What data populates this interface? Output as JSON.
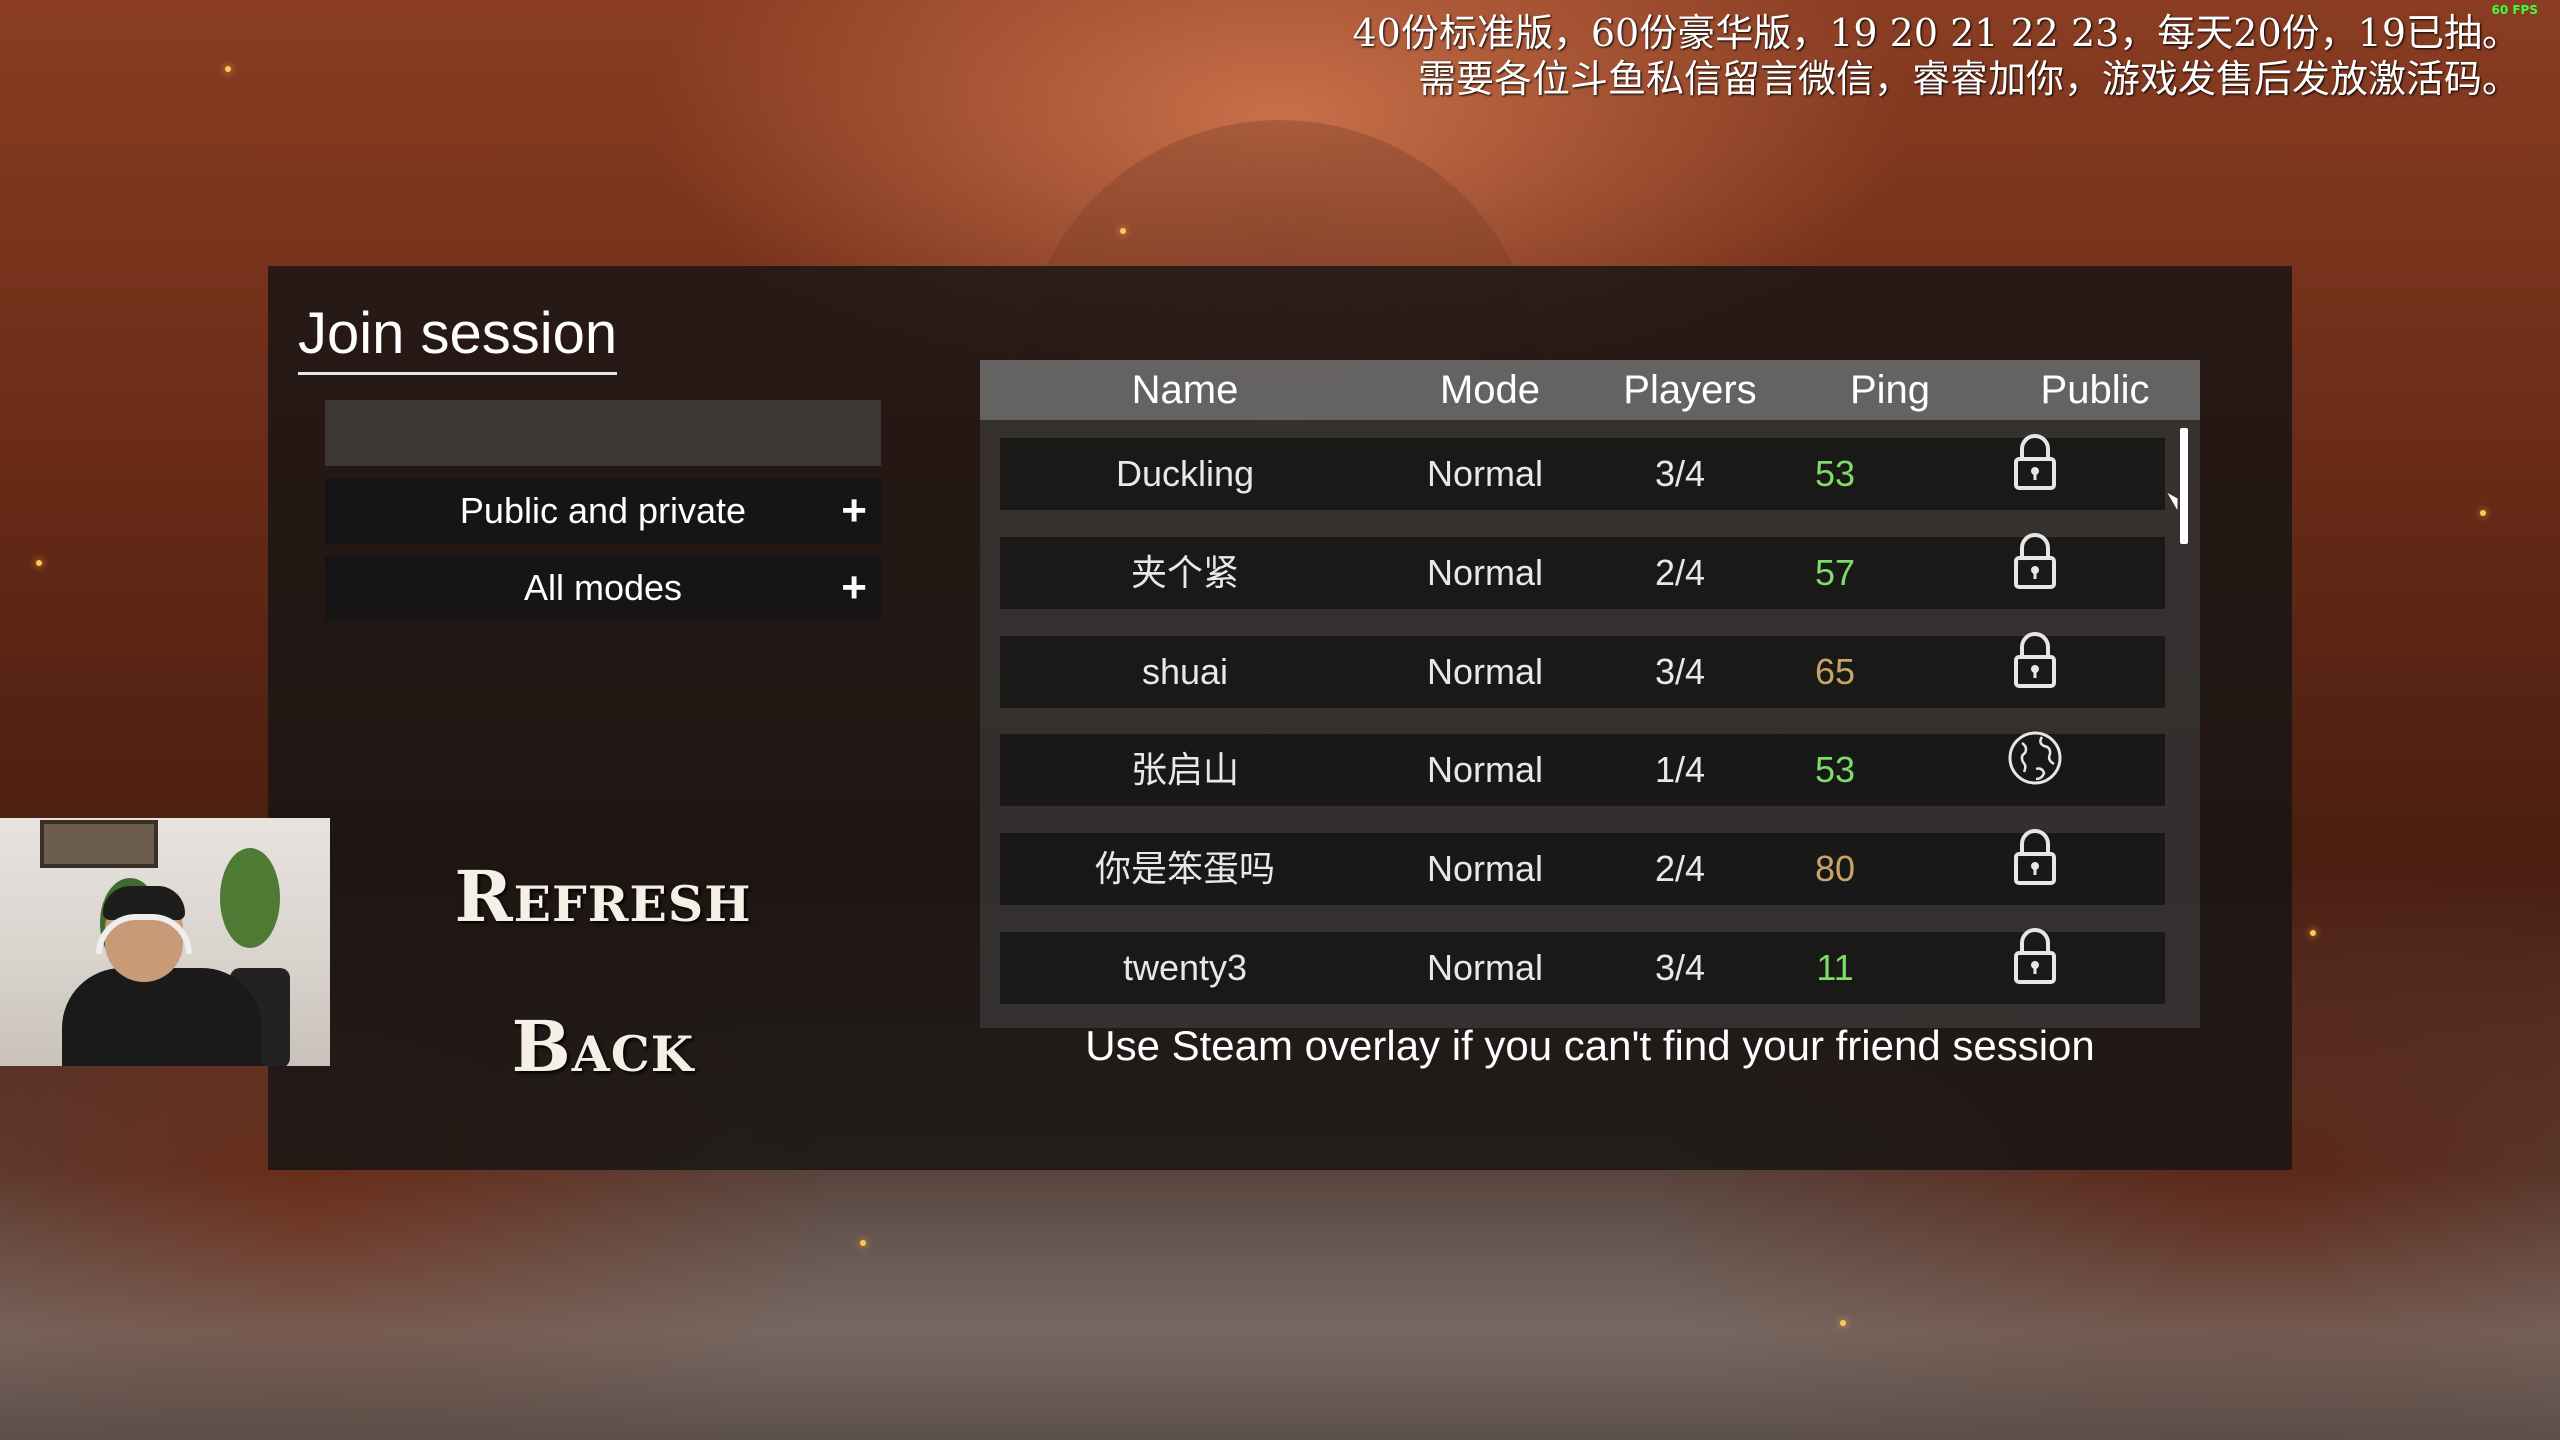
{
  "overlay": {
    "fps": "60 FPS",
    "announce_line1": "40份标准版，60份豪华版，19 20 21 22 23，每天20份，19已抽。",
    "announce_line2": "需要各位斗鱼私信留言微信，睿睿加你，游戏发售后发放激活码。"
  },
  "menu": {
    "title": "Join session",
    "search_value": "",
    "filter_visibility": "Public and private",
    "filter_mode": "All modes",
    "filter_expand_symbol": "+",
    "refresh_label": "Refresh",
    "back_label": "Back"
  },
  "table": {
    "headers": {
      "name": "Name",
      "mode": "Mode",
      "players": "Players",
      "ping": "Ping",
      "public": "Public"
    },
    "rows": [
      {
        "name": "Duckling",
        "mode": "Normal",
        "players": "3/4",
        "ping": "53",
        "ping_color": "#7ddc6a",
        "public_icon": "lock-icon"
      },
      {
        "name": "夹个紧",
        "mode": "Normal",
        "players": "2/4",
        "ping": "57",
        "ping_color": "#7ddc6a",
        "public_icon": "lock-icon"
      },
      {
        "name": "shuai",
        "mode": "Normal",
        "players": "3/4",
        "ping": "65",
        "ping_color": "#c8a468",
        "public_icon": "lock-icon"
      },
      {
        "name": "张启山",
        "mode": "Normal",
        "players": "1/4",
        "ping": "53",
        "ping_color": "#7ddc6a",
        "public_icon": "globe-icon"
      },
      {
        "name": "你是笨蛋吗",
        "mode": "Normal",
        "players": "2/4",
        "ping": "80",
        "ping_color": "#c8a468",
        "public_icon": "lock-icon"
      },
      {
        "name": "twenty3",
        "mode": "Normal",
        "players": "3/4",
        "ping": "11",
        "ping_color": "#7ddc6a",
        "public_icon": "lock-icon"
      }
    ],
    "hint": "Use Steam overlay if you can't find your friend session"
  }
}
